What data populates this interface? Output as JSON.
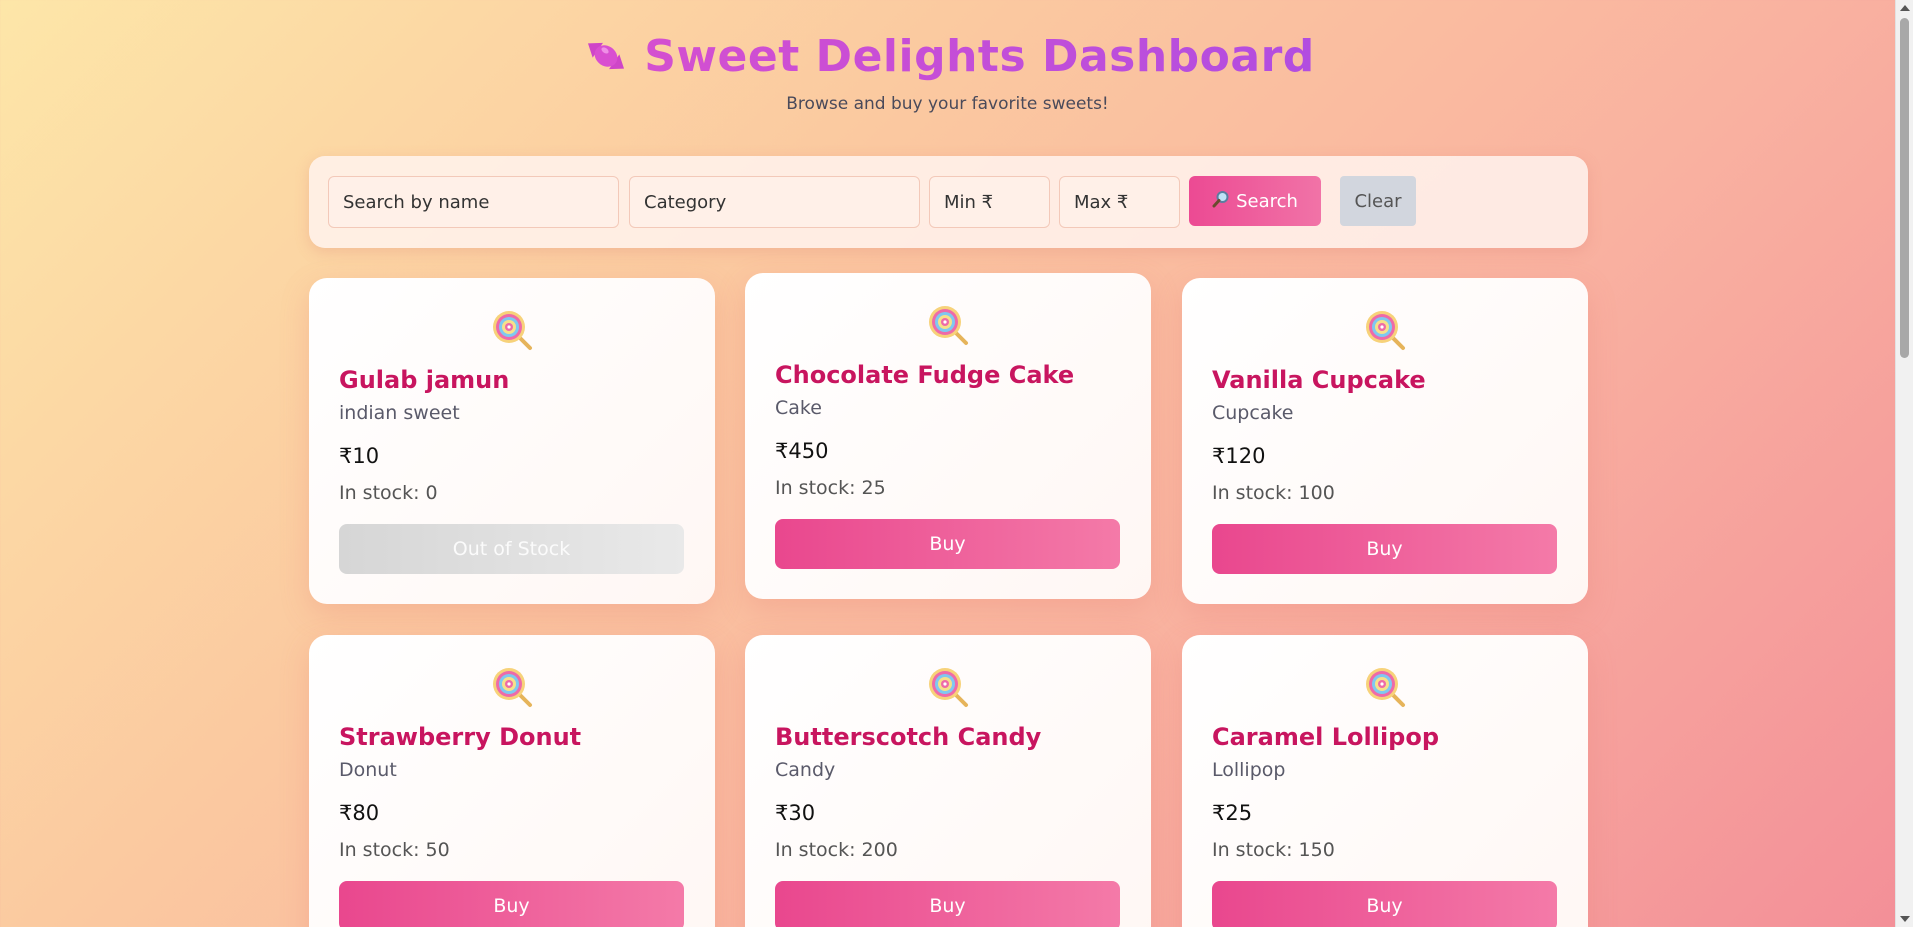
{
  "header": {
    "title": "Sweet Delights Dashboard",
    "subtitle": "Browse and buy your favorite sweets!",
    "logo_icon": "candy-icon"
  },
  "search": {
    "name_placeholder": "Search by name",
    "category_placeholder": "Category",
    "min_placeholder": "Min ₹",
    "max_placeholder": "Max ₹",
    "search_icon": "magnifier-icon",
    "search_label": "Search",
    "clear_label": "Clear"
  },
  "sweets": [
    {
      "name": "Gulab jamun",
      "category": "indian sweet",
      "price": "₹10",
      "stock": "In stock: 0",
      "button": "Out of Stock",
      "available": false
    },
    {
      "name": "Chocolate Fudge Cake",
      "category": "Cake",
      "price": "₹450",
      "stock": "In stock: 25",
      "button": "Buy",
      "available": true
    },
    {
      "name": "Vanilla Cupcake",
      "category": "Cupcake",
      "price": "₹120",
      "stock": "In stock: 100",
      "button": "Buy",
      "available": true
    },
    {
      "name": "Strawberry Donut",
      "category": "Donut",
      "price": "₹80",
      "stock": "In stock: 50",
      "button": "Buy",
      "available": true
    },
    {
      "name": "Butterscotch Candy",
      "category": "Candy",
      "price": "₹30",
      "stock": "In stock: 200",
      "button": "Buy",
      "available": true
    },
    {
      "name": "Caramel Lollipop",
      "category": "Lollipop",
      "price": "₹25",
      "stock": "In stock: 150",
      "button": "Buy",
      "available": true
    }
  ],
  "card_icon": "lollipop-icon",
  "colors": {
    "title": "#c04fd8",
    "sweet_name": "#c8155f",
    "buy_button": "#ec4a93",
    "clear_button": "#d2d6de"
  }
}
